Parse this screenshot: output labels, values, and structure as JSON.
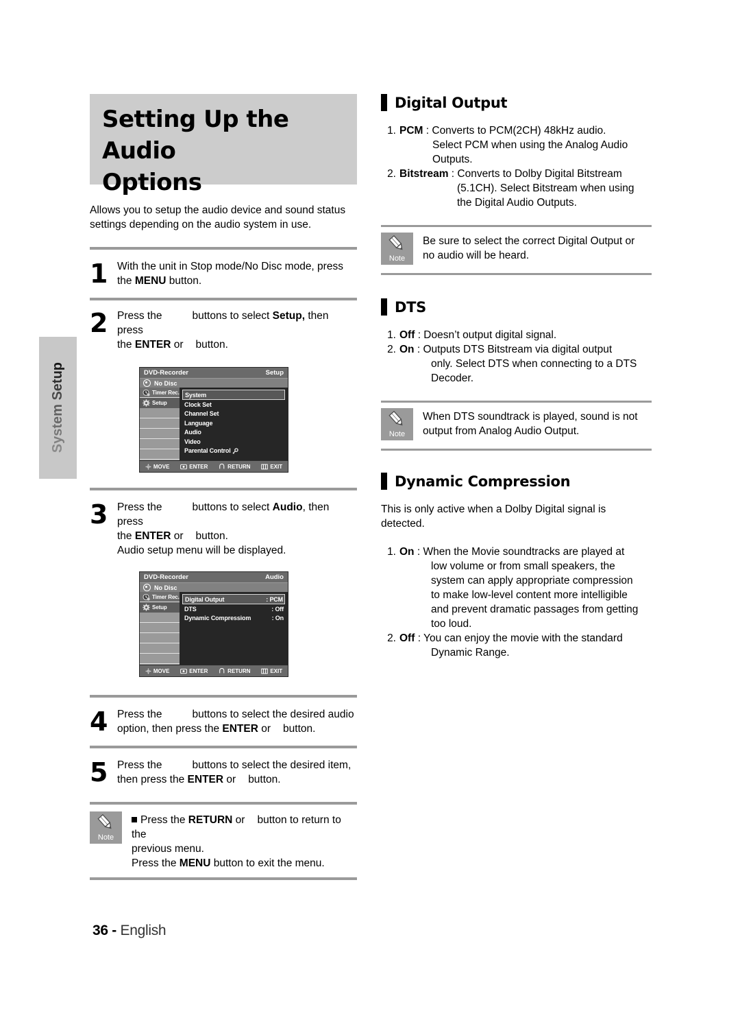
{
  "side_tab": {
    "label": "System Setup"
  },
  "chapter": {
    "title_line1": "Setting Up the Audio",
    "title_line2": "Options",
    "intro": "Allows you to setup the audio device and sound status settings depending on the audio system in use."
  },
  "steps": [
    {
      "num": "1",
      "l1_a": "With the unit in Stop mode/No Disc mode, press",
      "l2_a": "the ",
      "l2_b": "MENU",
      "l2_c": " button."
    },
    {
      "num": "2",
      "l1_a": "Press the",
      "l1_b": "buttons to select ",
      "l1_c": "Setup,",
      "l1_d": " then press",
      "l2_a": "the ",
      "l2_b": "ENTER",
      "l2_c": " or",
      "l2_d": "button."
    },
    {
      "num": "3",
      "l1_a": "Press the",
      "l1_b": "buttons to select ",
      "l1_c": "Audio",
      "l1_d": ", then press",
      "l2_a": "the  ",
      "l2_b": "ENTER",
      "l2_c": " or",
      "l2_d": "button.",
      "l3": "Audio setup menu will be displayed."
    },
    {
      "num": "4",
      "l1_a": "Press the",
      "l1_b": "buttons to select the desired audio",
      "l2_a": "option, then press the ",
      "l2_b": "ENTER",
      "l2_c": " or",
      "l2_d": "button."
    },
    {
      "num": "5",
      "l1_a": "Press the",
      "l1_b": "buttons to select the desired item,",
      "l2_a": "then press the ",
      "l2_b": "ENTER",
      "l2_c": " or",
      "l2_d": "button."
    }
  ],
  "osd_setup": {
    "header_left": "DVD-Recorder",
    "header_right": "Setup",
    "disc_status": "No Disc",
    "side_items": [
      {
        "label": "Timer Rec.",
        "icon": "timer-rec-icon",
        "state": "dark"
      },
      {
        "label": "Setup",
        "icon": "gear-icon",
        "state": "selected"
      }
    ],
    "menu_items": [
      {
        "label": "System",
        "selected": true
      },
      {
        "label": "Clock Set",
        "selected": false
      },
      {
        "label": "Channel Set",
        "selected": false
      },
      {
        "label": "Language",
        "selected": false
      },
      {
        "label": "Audio",
        "selected": false
      },
      {
        "label": "Video",
        "selected": false
      },
      {
        "label": "Parental Control",
        "selected": false,
        "suffix": "key-icon"
      }
    ],
    "footer_buttons": [
      {
        "icon": "dpad-icon",
        "label": "MOVE"
      },
      {
        "icon": "enter-icon",
        "label": "ENTER"
      },
      {
        "icon": "return-icon",
        "label": "RETURN"
      },
      {
        "icon": "exit-icon",
        "label": "EXIT"
      }
    ]
  },
  "osd_audio": {
    "header_left": "DVD-Recorder",
    "header_right": "Audio",
    "disc_status": "No Disc",
    "side_items": [
      {
        "label": "Timer Rec.",
        "icon": "timer-rec-icon",
        "state": "dark"
      },
      {
        "label": "Setup",
        "icon": "gear-icon",
        "state": "selected"
      }
    ],
    "menu_items": [
      {
        "label": "Digital Output",
        "value": ": PCM",
        "selected": true
      },
      {
        "label": "DTS",
        "value": ": Off",
        "selected": false
      },
      {
        "label": "Dynamic Compressiom",
        "value": ": On",
        "selected": false
      }
    ],
    "footer_buttons": [
      {
        "icon": "dpad-icon",
        "label": "MOVE"
      },
      {
        "icon": "enter-icon",
        "label": "ENTER"
      },
      {
        "icon": "return-icon",
        "label": "RETURN"
      },
      {
        "icon": "exit-icon",
        "label": "EXIT"
      }
    ]
  },
  "note_left": {
    "label": "Note",
    "line1_a": "Press the ",
    "line1_b": "RETURN",
    "line1_c": " or",
    "line1_d": "button to return to the",
    "line2": "previous menu.",
    "line3_a": "Press the ",
    "line3_b": "MENU",
    "line3_c": " button to exit the menu."
  },
  "sections": [
    {
      "title": "Digital Output",
      "items": [
        {
          "marker": "1.",
          "bold": "PCM",
          "rest": " : Converts to PCM(2CH) 48kHz audio.",
          "cont": [
            "Select PCM when using the Analog Audio",
            "Outputs."
          ]
        },
        {
          "marker": "2.",
          "bold": "Bitstream",
          "rest": " : Converts to Dolby Digital Bitstream",
          "cont": [
            "(5.1CH). Select Bitstream when using",
            "the Digital Audio Outputs."
          ]
        }
      ],
      "note": {
        "label": "Note",
        "line1": "Be sure to select the correct Digital Output or",
        "line2": "no audio will be heard."
      }
    },
    {
      "title": "DTS",
      "items": [
        {
          "marker": "1.",
          "bold": "Off",
          "rest": " : Doesn’t output digital signal.",
          "cont": []
        },
        {
          "marker": "2.",
          "bold": "On",
          "rest": " : Outputs DTS Bitstream via digital output",
          "cont": [
            "only. Select DTS when connecting to a DTS",
            "Decoder."
          ]
        }
      ],
      "note": {
        "label": "Note",
        "line1": "When DTS soundtrack is played, sound is not",
        "line2": "output from Analog Audio Output."
      }
    },
    {
      "title": "Dynamic Compression",
      "lead": "This is only active when a Dolby Digital signal is detected.",
      "items": [
        {
          "marker": "1.",
          "bold": "On",
          "rest": " : When the Movie soundtracks are played at",
          "cont": [
            "low volume or from small speakers, the",
            "system can apply appropriate compression",
            "to make low-level content more intelligible",
            "and prevent dramatic passages from getting",
            "too loud."
          ]
        },
        {
          "marker": "2.",
          "bold": "Off",
          "rest": " : You can enjoy the movie with the standard",
          "cont": [
            " Dynamic Range."
          ]
        }
      ]
    }
  ],
  "footer": {
    "page": "36",
    "dash": " - ",
    "language": "English"
  }
}
